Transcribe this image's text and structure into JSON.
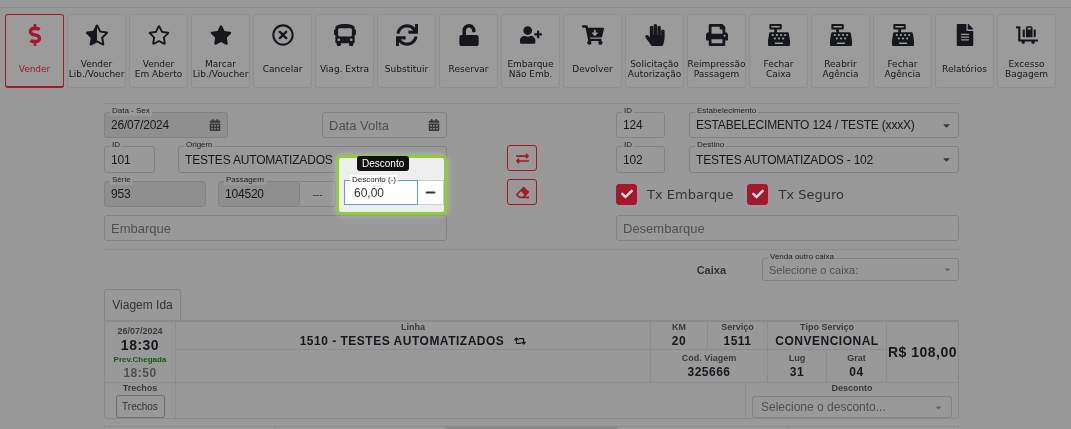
{
  "toolbar": [
    {
      "label": "Vender",
      "selected": true
    },
    {
      "label": "Vender\nLib./Voucher",
      "selected": false
    },
    {
      "label": "Vender\nEm Aberto",
      "selected": false
    },
    {
      "label": "Marcar\nLib./Voucher",
      "selected": false
    },
    {
      "label": "Cancelar",
      "selected": false
    },
    {
      "label": "Viag. Extra",
      "selected": false
    },
    {
      "label": "Substituir",
      "selected": false
    },
    {
      "label": "Reservar",
      "selected": false
    },
    {
      "label": "Embarque\nNão Emb.",
      "selected": false
    },
    {
      "label": "Devolver",
      "selected": false
    },
    {
      "label": "Solicitação\nAutorização",
      "selected": false
    },
    {
      "label": "Reimpressão\nPassagem",
      "selected": false
    },
    {
      "label": "Fechar\nCaixa",
      "selected": false
    },
    {
      "label": "Reabrir\nAgência",
      "selected": false
    },
    {
      "label": "Fechar\nAgência",
      "selected": false
    },
    {
      "label": "Relatórios",
      "selected": false
    },
    {
      "label": "Excesso\nBagagem",
      "selected": false
    }
  ],
  "form": {
    "date": {
      "label": "Data - Sex",
      "value": "26/07/2024"
    },
    "return_date": {
      "placeholder": "Data Volta"
    },
    "origin_id": {
      "label": "ID",
      "value": "101"
    },
    "origin": {
      "label": "Origem",
      "value": "TESTES AUTOMATIZADOS"
    },
    "series": {
      "label": "Série",
      "value": "953"
    },
    "ticket": {
      "label": "Passagem",
      "value": "104520",
      "button": "---"
    },
    "boarding": {
      "placeholder": "Embarque"
    },
    "establishment_id": {
      "label": "ID",
      "value": "124"
    },
    "establishment": {
      "label": "Estabelecimento",
      "value": "ESTABELECIMENTO 124 / TESTE (xxxX)"
    },
    "destination_id": {
      "label": "ID",
      "value": "102"
    },
    "destination": {
      "label": "Destino",
      "value": "TESTES AUTOMATIZADOS - 102"
    },
    "checkboxes": [
      {
        "label": "Tx Embarque",
        "checked": true
      },
      {
        "label": "Tx Seguro",
        "checked": true
      }
    ],
    "alighting": {
      "placeholder": "Desembarque"
    },
    "cashier": {
      "label": "Caixa",
      "select_label": "Venda outro caixa",
      "placeholder": "Selecione o caixa:"
    }
  },
  "highlight": {
    "tooltip": "Desconto",
    "field_label": "Desconto (-)",
    "value": "60,00"
  },
  "tabs": [
    {
      "label": "Viagem Ida",
      "selected": true
    }
  ],
  "trip": {
    "date": "26/07/2024",
    "departure": "18:30",
    "arrival_label": "Prev.Chegada",
    "arrival": "18:50",
    "line_label": "Linha",
    "line": "1510 - TESTES AUTOMATIZADOS",
    "km_label": "KM",
    "km": "20",
    "service_label": "Serviço",
    "service": "1511",
    "service_type_label": "Tipo Serviço",
    "service_type": "CONVENCIONAL",
    "price": "R$ 108,00",
    "trip_code_label": "Cod. Viagem",
    "trip_code": "325666",
    "seat_label": "Lug",
    "seat": "31",
    "free_label": "Grat",
    "free": "04",
    "segments_label": "Trechos",
    "segments_button": "Trechos",
    "discount_label": "Desconto",
    "discount_placeholder": "Selecione o desconto..."
  }
}
